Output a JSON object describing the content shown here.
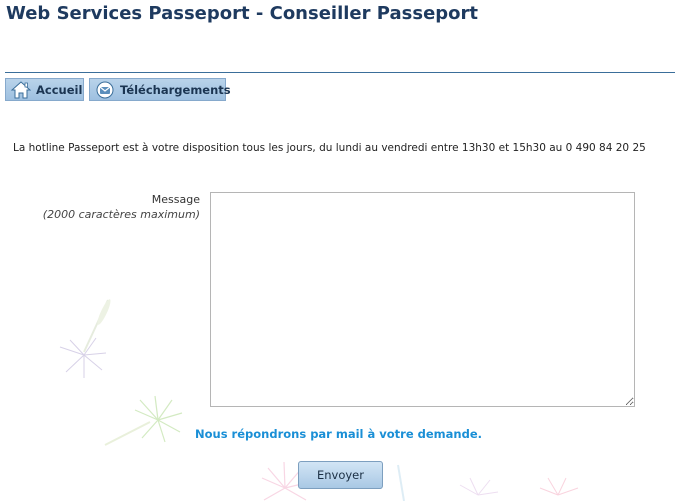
{
  "page": {
    "title": "Web Services Passeport - Conseiller Passeport"
  },
  "nav": {
    "home": {
      "label": "Accueil",
      "icon": "home-icon"
    },
    "downloads": {
      "label": "Téléchargements",
      "icon": "envelope-download-icon"
    }
  },
  "info": {
    "hotline": "La hotline Passeport est à votre disposition tous les jours, du lundi au vendredi entre 13h30 et 15h30 au 0 490 84 20 25"
  },
  "form": {
    "message_label": "Message",
    "message_hint": "(2000 caractères maximum)",
    "message_value": "",
    "reply_note": "Nous répondrons par mail à votre demande.",
    "submit_label": "Envoyer"
  },
  "colors": {
    "title": "#1e3a5f",
    "rule": "#3a6e9a",
    "nav_bg": "#b9d3ea",
    "reply_note": "#1a8fd6"
  }
}
